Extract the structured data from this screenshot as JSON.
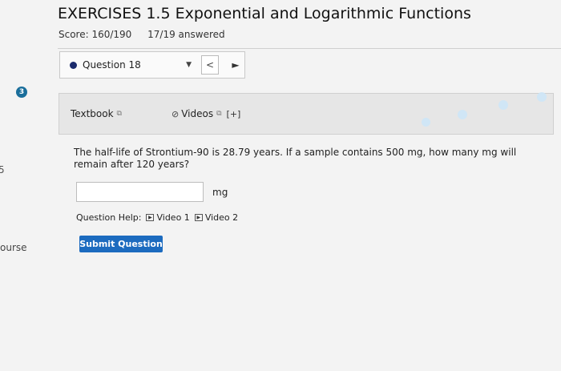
{
  "header": {
    "title": "EXERCISES 1.5 Exponential and Logarithmic Functions",
    "score": "Score: 160/190",
    "answered": "17/19 answered"
  },
  "question_nav": {
    "label": "Question 18",
    "caret": "▼",
    "prev": "<",
    "next": "►"
  },
  "step_number": "3",
  "resources": {
    "textbook": "Textbook",
    "videos": "Videos",
    "expand": "[+]"
  },
  "question": {
    "text": "The half-life of Strontium-90 is 28.79 years. If a sample contains 500 mg, how many mg will remain after 120 years?",
    "answer_value": "",
    "unit": "mg"
  },
  "help": {
    "label": "Question Help:",
    "video1": "Video 1",
    "video2": "Video 2"
  },
  "submit_label": "Submit Question",
  "left_fragments": {
    "top": "5",
    "bottom": "ourse"
  },
  "colors": {
    "submit_bg": "#1c6bbf",
    "badge_bg": "#1a6e9b",
    "question_dot": "#1a2a6c",
    "resource_bar_bg": "#e6e6e6"
  }
}
